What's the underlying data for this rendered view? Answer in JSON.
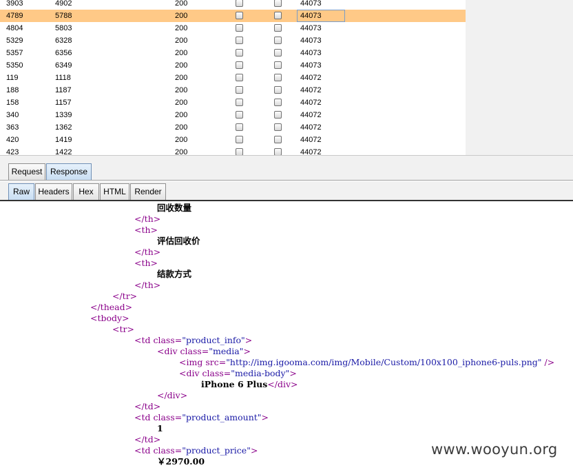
{
  "results": {
    "rows": [
      {
        "request": "3903",
        "payload": "4902",
        "status": "200",
        "length": "44073"
      },
      {
        "request": "4789",
        "payload": "5788",
        "status": "200",
        "length": "44073"
      },
      {
        "request": "4804",
        "payload": "5803",
        "status": "200",
        "length": "44073"
      },
      {
        "request": "5329",
        "payload": "6328",
        "status": "200",
        "length": "44073"
      },
      {
        "request": "5357",
        "payload": "6356",
        "status": "200",
        "length": "44073"
      },
      {
        "request": "5350",
        "payload": "6349",
        "status": "200",
        "length": "44073"
      },
      {
        "request": "119",
        "payload": "1118",
        "status": "200",
        "length": "44072"
      },
      {
        "request": "188",
        "payload": "1187",
        "status": "200",
        "length": "44072"
      },
      {
        "request": "158",
        "payload": "1157",
        "status": "200",
        "length": "44072"
      },
      {
        "request": "340",
        "payload": "1339",
        "status": "200",
        "length": "44072"
      },
      {
        "request": "363",
        "payload": "1362",
        "status": "200",
        "length": "44072"
      },
      {
        "request": "420",
        "payload": "1419",
        "status": "200",
        "length": "44072"
      },
      {
        "request": "423",
        "payload": "1422",
        "status": "200",
        "length": "44072"
      }
    ],
    "selected_row": 1,
    "selection_color": "#ffc987"
  },
  "message_tabs": {
    "request": "Request",
    "response": "Response",
    "active": "Response"
  },
  "view_tabs": {
    "raw": "Raw",
    "headers": "Headers",
    "hex": "Hex",
    "html": "HTML",
    "render": "Render",
    "active": "Raw"
  },
  "raw_lines": [
    [
      [
        "tx",
        "回收数量"
      ]
    ],
    [
      [
        "tg",
        "</th>"
      ]
    ],
    [
      [
        "tg",
        "<th>"
      ]
    ],
    [
      [
        "tx",
        "评估回收价"
      ]
    ],
    [
      [
        "tg",
        "</th>"
      ]
    ],
    [
      [
        "tg",
        "<th>"
      ]
    ],
    [
      [
        "tx",
        "结款方式"
      ]
    ],
    [
      [
        "tg",
        "</th>"
      ]
    ],
    [
      [
        "tg",
        "</tr>"
      ]
    ],
    [
      [
        "tg",
        "</thead>"
      ]
    ],
    [
      [
        "tg",
        "<tbody>"
      ]
    ],
    [
      [
        "tg",
        "<tr>"
      ]
    ],
    [
      [
        "tg",
        "<td "
      ],
      [
        "at",
        "class="
      ],
      [
        "vl",
        "\"product_info\""
      ],
      [
        "tg",
        ">"
      ]
    ],
    [
      [
        "tg",
        "<div "
      ],
      [
        "at",
        "class="
      ],
      [
        "vl",
        "\"media\""
      ],
      [
        "tg",
        ">"
      ]
    ],
    [
      [
        "tg",
        "<img "
      ],
      [
        "at",
        "src="
      ],
      [
        "vl",
        "\"http://img.igooma.com/img/Mobile/Custom/100x100_iphone6-puls.png\""
      ],
      [
        "tg",
        " />"
      ]
    ],
    [
      [
        "tg",
        "<div "
      ],
      [
        "at",
        "class="
      ],
      [
        "vl",
        "\"media-body\""
      ],
      [
        "tg",
        ">"
      ]
    ],
    [
      [
        "tx",
        "iPhone 6 Plus"
      ],
      [
        "tg",
        "</div>"
      ]
    ],
    [
      [
        "tg",
        "</div>"
      ]
    ],
    [
      [
        "tg",
        "</td>"
      ]
    ],
    [
      [
        "tg",
        "<td "
      ],
      [
        "at",
        "class="
      ],
      [
        "vl",
        "\"product_amount\""
      ],
      [
        "tg",
        ">"
      ]
    ],
    [
      [
        "tx",
        "1"
      ]
    ],
    [
      [
        "tg",
        "</td>"
      ]
    ],
    [
      [
        "tg",
        "<td "
      ],
      [
        "at",
        "class="
      ],
      [
        "vl",
        "\"product_price\""
      ],
      [
        "tg",
        ">"
      ]
    ],
    [
      [
        "tx",
        "￥2970.00"
      ]
    ]
  ],
  "watermark": "www.wooyun.org",
  "colors": {
    "tag": "#8a008a",
    "value": "#1a1aa6",
    "text": "#000000",
    "panel": "#f1f1f1"
  }
}
